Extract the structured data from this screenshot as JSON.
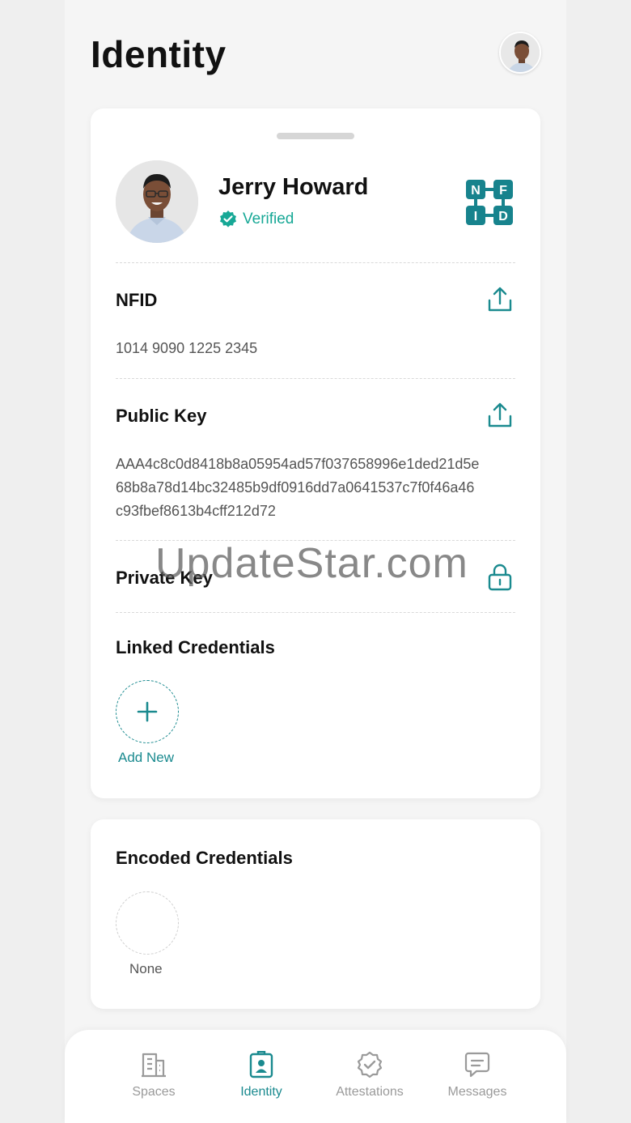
{
  "header": {
    "title": "Identity"
  },
  "profile": {
    "name": "Jerry Howard",
    "status": "Verified",
    "logo_letters": [
      "N",
      "F",
      "I",
      "D"
    ]
  },
  "sections": {
    "nfid": {
      "label": "NFID",
      "value": "1014 9090 1225 2345"
    },
    "public_key": {
      "label": "Public Key",
      "value_lines": [
        "AAA4c8c0d8418b8a05954ad57f037658996e1ded21d5e",
        "68b8a78d14bc32485b9df0916dd7a0641537c7f0f46a46",
        "c93fbef8613b4cff212d72"
      ]
    },
    "private_key": {
      "label": "Private Key"
    },
    "linked": {
      "label": "Linked Credentials",
      "add_label": "Add New"
    }
  },
  "encoded": {
    "label": "Encoded Credentials",
    "empty_label": "None"
  },
  "watermark": "UpdateStar.com",
  "tabs": [
    {
      "label": "Spaces",
      "icon": "building-icon",
      "active": false
    },
    {
      "label": "Identity",
      "icon": "id-badge-icon",
      "active": true
    },
    {
      "label": "Attestations",
      "icon": "badge-check-icon",
      "active": false
    },
    {
      "label": "Messages",
      "icon": "message-icon",
      "active": false
    }
  ],
  "colors": {
    "accent": "#1a8a8f",
    "verified": "#17a896",
    "inactive": "#9a9a9a"
  }
}
